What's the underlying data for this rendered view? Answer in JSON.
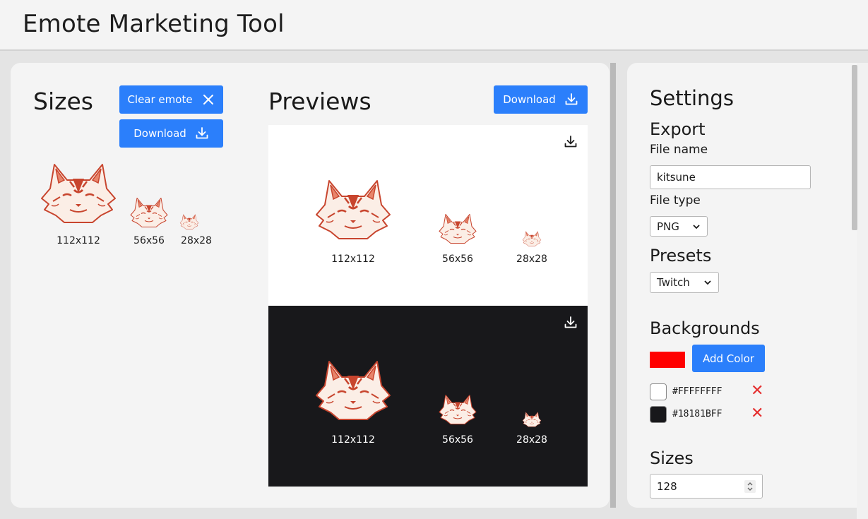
{
  "app": {
    "title": "Emote Marketing Tool"
  },
  "sizes_panel": {
    "heading": "Sizes",
    "clear_button": "Clear emote",
    "download_button": "Download",
    "thumbs": [
      {
        "label": "112x112"
      },
      {
        "label": "56x56"
      },
      {
        "label": "28x28"
      }
    ]
  },
  "previews_panel": {
    "heading": "Previews",
    "download_button": "Download",
    "backgrounds": [
      {
        "name": "white",
        "color": "#FFFFFF",
        "labels": [
          "112x112",
          "56x56",
          "28x28"
        ]
      },
      {
        "name": "dark",
        "color": "#18181B",
        "labels": [
          "112x112",
          "56x56",
          "28x28"
        ]
      }
    ]
  },
  "settings": {
    "heading": "Settings",
    "export": {
      "heading": "Export",
      "file_name_label": "File name",
      "file_name_value": "kitsune",
      "file_type_label": "File type",
      "file_type_value": "PNG"
    },
    "presets": {
      "heading": "Presets",
      "value": "Twitch"
    },
    "backgrounds": {
      "heading": "Backgrounds",
      "picker_color": "#FF0000",
      "add_button": "Add Color",
      "items": [
        {
          "hex": "#FFFFFFFF",
          "swatch": "#FFFFFF"
        },
        {
          "hex": "#18181BFF",
          "swatch": "#18181B"
        }
      ]
    },
    "sizes": {
      "heading": "Sizes",
      "value": "128"
    }
  },
  "icons": {
    "close": "close-icon",
    "download": "download-icon",
    "chevron": "chevron-down-icon",
    "remove": "remove-x-icon"
  },
  "colors": {
    "accent": "#2B7FFB",
    "remove": "#E52E2E",
    "emote_primary": "#C8452E",
    "emote_fill": "#FBEEE6"
  }
}
